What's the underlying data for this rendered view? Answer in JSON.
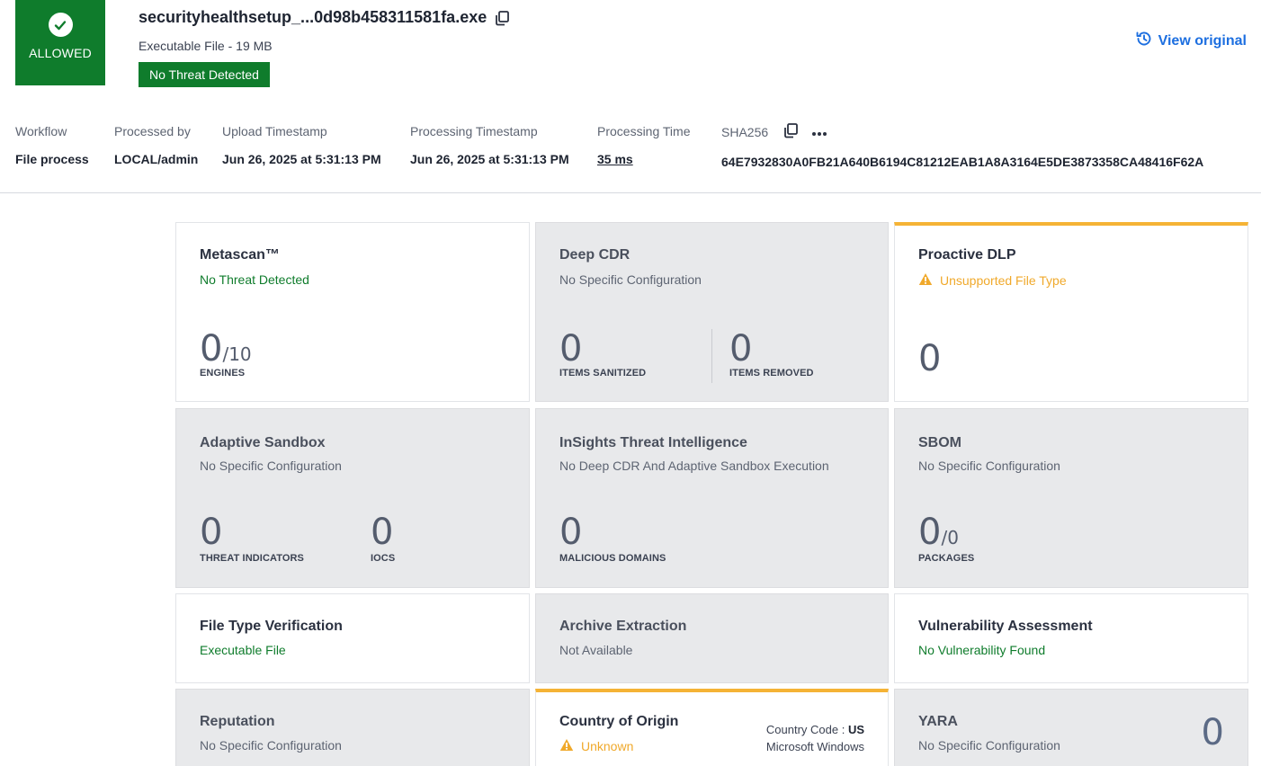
{
  "header": {
    "verdict": "ALLOWED",
    "file_name": "securityhealthsetup_...0d98b458311581fa.exe",
    "file_info": "Executable File - 19 MB",
    "threat_badge": "No Threat Detected",
    "view_original": "View original",
    "colors": {
      "allowed": "#0f7c2c",
      "link": "#1d6fe0",
      "warning": "#f5b335"
    }
  },
  "meta": {
    "workflow": {
      "label": "Workflow",
      "value": "File process"
    },
    "processed_by": {
      "label": "Processed by",
      "value": "LOCAL/admin"
    },
    "upload_ts": {
      "label": "Upload Timestamp",
      "value": "Jun 26, 2025 at 5:31:13 PM"
    },
    "processing_ts": {
      "label": "Processing Timestamp",
      "value": "Jun 26, 2025 at 5:31:13 PM"
    },
    "processing_time": {
      "label": "Processing Time",
      "value": "35 ms"
    },
    "sha256": {
      "label": "SHA256",
      "value": "64E7932830A0FB21A640B6194C81212EAB1A8A3164E5DE3873358CA48416F62A"
    }
  },
  "cards": {
    "metascan": {
      "title": "Metascan™",
      "status": "No Threat Detected",
      "count": "0",
      "denom": "/10",
      "unit": "ENGINES"
    },
    "deep_cdr": {
      "title": "Deep CDR",
      "status": "No Specific Configuration",
      "sanitized": "0",
      "sanitized_label": "ITEMS SANITIZED",
      "removed": "0",
      "removed_label": "ITEMS REMOVED"
    },
    "proactive_dlp": {
      "title": "Proactive DLP",
      "status": "Unsupported File Type",
      "count": "0"
    },
    "adaptive_sandbox": {
      "title": "Adaptive Sandbox",
      "status": "No Specific Configuration",
      "threats": "0",
      "threats_label": "THREAT INDICATORS",
      "iocs": "0",
      "iocs_label": "IOCS"
    },
    "insights": {
      "title": "InSights Threat Intelligence",
      "status": "No Deep CDR And Adaptive Sandbox Execution",
      "domains": "0",
      "domains_label": "MALICIOUS DOMAINS"
    },
    "sbom": {
      "title": "SBOM",
      "status": "No Specific Configuration",
      "count": "0",
      "denom": "/0",
      "unit": "PACKAGES"
    },
    "file_type": {
      "title": "File Type Verification",
      "status": "Executable File"
    },
    "archive": {
      "title": "Archive Extraction",
      "status": "Not Available"
    },
    "vulnerability": {
      "title": "Vulnerability Assessment",
      "status": "No Vulnerability Found"
    },
    "reputation": {
      "title": "Reputation",
      "status": "No Specific Configuration"
    },
    "country": {
      "title": "Country of Origin",
      "status": "Unknown",
      "code_label": "Country Code : ",
      "code": "US",
      "vendor": "Microsoft Windows"
    },
    "yara": {
      "title": "YARA",
      "status": "No Specific Configuration",
      "count": "0"
    }
  },
  "icons": [
    "check-circle-icon",
    "copy-icon",
    "history-icon",
    "more-dots-icon",
    "warning-icon"
  ]
}
